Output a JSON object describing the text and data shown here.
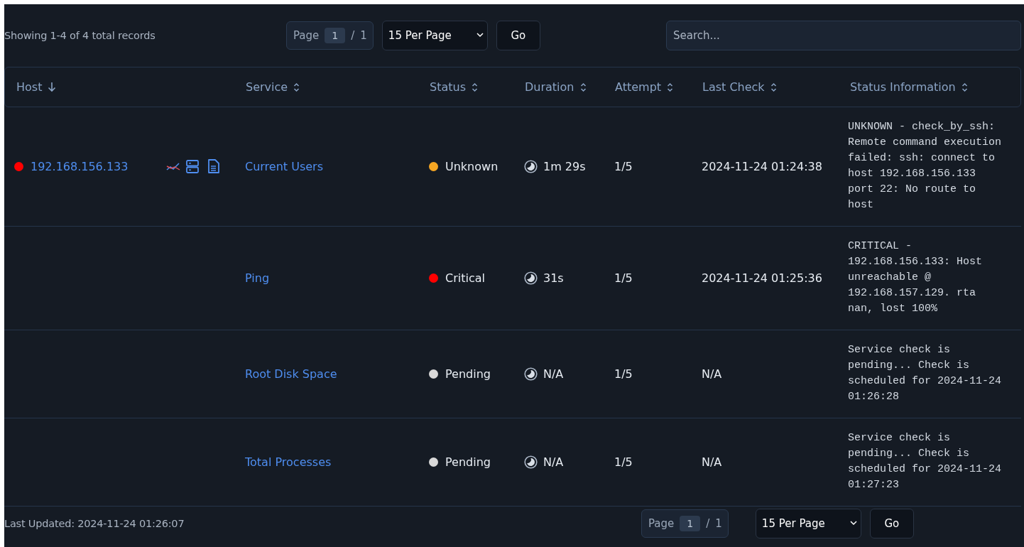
{
  "summary": "Showing 1-4 of 4 total records",
  "pager_top": {
    "label": "Page",
    "page": "1",
    "separator": "/",
    "total": "1",
    "per_page": "15 Per Page",
    "go": "Go"
  },
  "search": {
    "placeholder": "Search..."
  },
  "columns": [
    {
      "label": "Host",
      "sorted": true
    },
    {
      "label": "Service",
      "sorted": false
    },
    {
      "label": "Status",
      "sorted": false
    },
    {
      "label": "Duration",
      "sorted": false
    },
    {
      "label": "Attempt",
      "sorted": false
    },
    {
      "label": "Last Check",
      "sorted": false
    },
    {
      "label": "Status Information",
      "sorted": false
    }
  ],
  "rows": [
    {
      "host": {
        "label": "192.168.156.133",
        "color": "#ff0000"
      },
      "service": "Current Users",
      "status": "Unknown",
      "color": "#f5a623",
      "duration": "1m 29s",
      "attempt": "1/5",
      "last_check": "2024-11-24 01:24:38",
      "info": "UNKNOWN - check_by_ssh: Remote command execution failed: ssh: connect to host 192.168.156.133 port 22: No route to host"
    },
    {
      "service": "Ping",
      "status": "Critical",
      "color": "#ff0000",
      "duration": "31s",
      "attempt": "1/5",
      "last_check": "2024-11-24 01:25:36",
      "info": "CRITICAL - 192.168.156.133: Host unreachable @ 192.168.157.129. rta nan, lost 100%"
    },
    {
      "service": "Root Disk Space",
      "status": "Pending",
      "color": "#d9d9d9",
      "duration": "N/A",
      "attempt": "1/5",
      "last_check": "N/A",
      "info": "Service check is pending... Check is scheduled for 2024-11-24 01:26:28"
    },
    {
      "service": "Total Processes",
      "status": "Pending",
      "color": "#d9d9d9",
      "duration": "N/A",
      "attempt": "1/5",
      "last_check": "N/A",
      "info": "Service check is pending... Check is scheduled for 2024-11-24 01:27:23"
    }
  ],
  "last_updated": "Last Updated: 2024-11-24 01:26:07",
  "pager_bottom": {
    "label": "Page",
    "page": "1",
    "separator": "/",
    "total": "1",
    "per_page": "15 Per Page",
    "go": "Go"
  }
}
